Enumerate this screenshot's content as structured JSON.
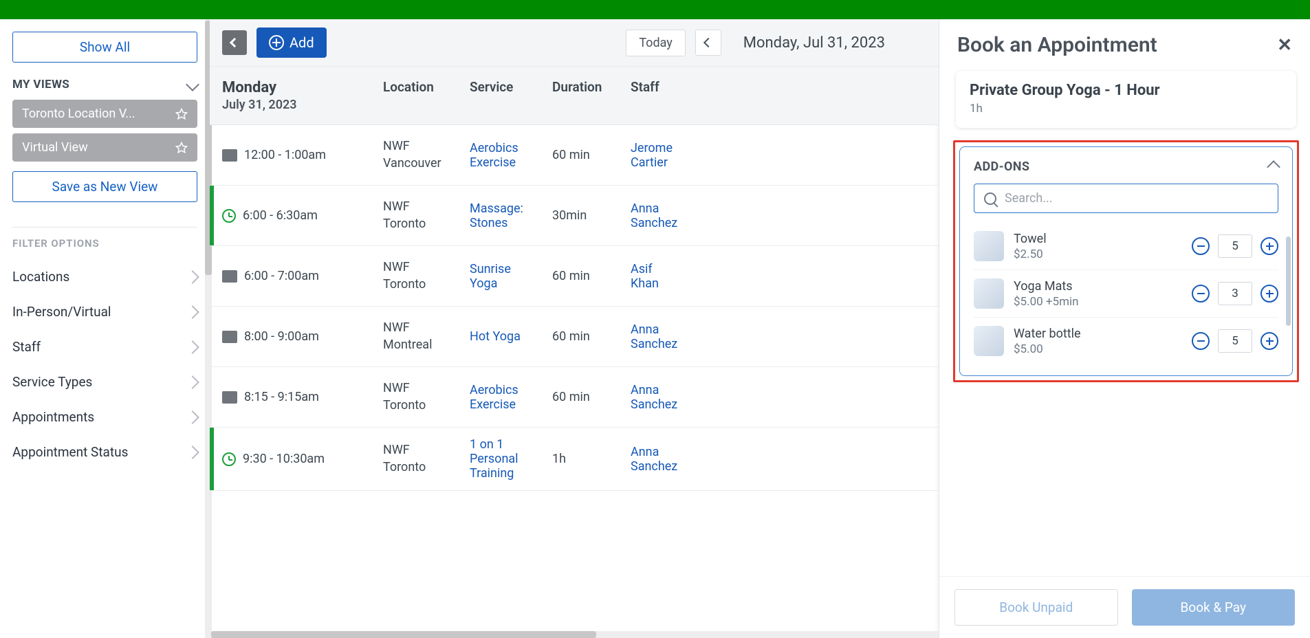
{
  "sidebar": {
    "show_all": "Show All",
    "my_views_label": "MY VIEWS",
    "views": [
      {
        "label": "Toronto Location V..."
      },
      {
        "label": "Virtual View"
      }
    ],
    "save_view": "Save as New View",
    "filter_label": "FILTER OPTIONS",
    "filters": [
      "Locations",
      "In-Person/Virtual",
      "Staff",
      "Service Types",
      "Appointments",
      "Appointment Status"
    ]
  },
  "toolbar": {
    "add": "Add",
    "today": "Today",
    "date": "Monday, Jul 31, 2023"
  },
  "table": {
    "day": "Monday",
    "day_sub": "July 31, 2023",
    "cols": {
      "location": "Location",
      "service": "Service",
      "duration": "Duration",
      "staff": "Staff"
    },
    "rows": [
      {
        "stripe": "",
        "icon": "box",
        "time": "12:00 - 1:00am",
        "loc": "NWF Vancouver",
        "svc": "Aerobics Exercise",
        "dur": "60 min",
        "staff": "Jerome Cartier"
      },
      {
        "stripe": "#1b9e3a",
        "icon": "clock",
        "time": "6:00 - 6:30am",
        "loc": "NWF Toronto",
        "svc": "Massage: Stones",
        "dur": "30min",
        "staff": "Anna Sanchez"
      },
      {
        "stripe": "",
        "icon": "box",
        "time": "6:00 - 7:00am",
        "loc": "NWF Toronto",
        "svc": "Sunrise Yoga",
        "dur": "60 min",
        "staff": "Asif Khan"
      },
      {
        "stripe": "",
        "icon": "box",
        "time": "8:00 - 9:00am",
        "loc": "NWF Montreal",
        "svc": "Hot Yoga",
        "dur": "60 min",
        "staff": "Anna Sanchez"
      },
      {
        "stripe": "",
        "icon": "box",
        "time": "8:15 - 9:15am",
        "loc": "NWF Toronto",
        "svc": "Aerobics Exercise",
        "dur": "60 min",
        "staff": "Anna Sanchez"
      },
      {
        "stripe": "#1b9e3a",
        "icon": "clock",
        "time": "9:30 - 10:30am",
        "loc": "NWF Toronto",
        "svc": "1 on 1 Personal Training",
        "dur": "1h",
        "staff": "Anna Sanchez"
      }
    ]
  },
  "panel": {
    "title": "Book an Appointment",
    "service": {
      "name": "Private Group Yoga - 1 Hour",
      "dur": "1h"
    },
    "addons": {
      "label": "ADD-ONS",
      "search_placeholder": "Search...",
      "items": [
        {
          "name": "Towel",
          "price": "$2.50",
          "qty": "5"
        },
        {
          "name": "Yoga Mats",
          "price": "$5.00 +5min",
          "qty": "3"
        },
        {
          "name": "Water bottle",
          "price": "$5.00",
          "qty": "5"
        }
      ]
    },
    "footer": {
      "unpaid": "Book Unpaid",
      "pay": "Book & Pay"
    }
  }
}
